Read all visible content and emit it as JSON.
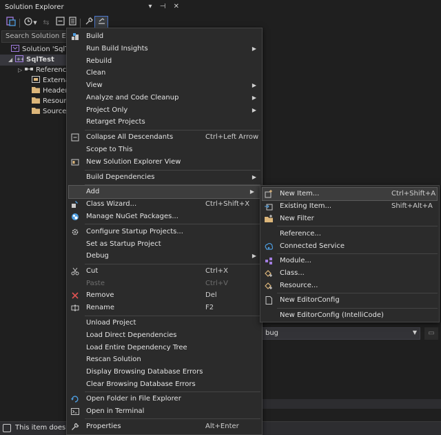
{
  "solution_explorer": {
    "title": "Solution Explorer",
    "title_controls": "▾ ⊣ ✕",
    "search_placeholder": "Search Solution Explo",
    "tree": [
      {
        "label": "Solution 'SqlTe",
        "icon": "solution-icon"
      },
      {
        "label": "SqlTest",
        "icon": "project-icon",
        "selected": true
      },
      {
        "label": "Referenc",
        "icon": "references-icon"
      },
      {
        "label": "External",
        "icon": "external-deps-icon"
      },
      {
        "label": "Header F",
        "icon": "folder-icon"
      },
      {
        "label": "Resource",
        "icon": "folder-icon"
      },
      {
        "label": "Source F",
        "icon": "folder-icon"
      }
    ]
  },
  "context_menu": {
    "items": [
      {
        "label": "Build",
        "shortcut": "",
        "icon": "build-icon"
      },
      {
        "label": "Run Build Insights",
        "shortcut": "",
        "submenu": true
      },
      {
        "label": "Rebuild",
        "shortcut": ""
      },
      {
        "label": "Clean",
        "shortcut": ""
      },
      {
        "label": "View",
        "shortcut": "",
        "submenu": true
      },
      {
        "label": "Analyze and Code Cleanup",
        "shortcut": "",
        "submenu": true
      },
      {
        "label": "Project Only",
        "shortcut": "",
        "submenu": true
      },
      {
        "label": "Retarget Projects",
        "shortcut": ""
      },
      {
        "label": "Collapse All Descendants",
        "shortcut": "Ctrl+Left Arrow",
        "icon": "collapse-icon"
      },
      {
        "label": "Scope to This",
        "shortcut": ""
      },
      {
        "label": "New Solution Explorer View",
        "shortcut": "",
        "icon": "new-view-icon"
      },
      {
        "label": "Build Dependencies",
        "shortcut": "",
        "submenu": true
      },
      {
        "label": "Add",
        "shortcut": "",
        "submenu": true,
        "highlighted": true
      },
      {
        "label": "Class Wizard...",
        "shortcut": "Ctrl+Shift+X",
        "icon": "class-wizard-icon"
      },
      {
        "label": "Manage NuGet Packages...",
        "shortcut": "",
        "icon": "nuget-icon"
      },
      {
        "label": "Configure Startup Projects...",
        "shortcut": "",
        "icon": "gear-icon"
      },
      {
        "label": "Set as Startup Project",
        "shortcut": ""
      },
      {
        "label": "Debug",
        "shortcut": "",
        "submenu": true
      },
      {
        "label": "Cut",
        "shortcut": "Ctrl+X",
        "icon": "scissors-icon"
      },
      {
        "label": "Paste",
        "shortcut": "Ctrl+V",
        "disabled": true
      },
      {
        "label": "Remove",
        "shortcut": "Del",
        "icon": "remove-x-icon"
      },
      {
        "label": "Rename",
        "shortcut": "F2",
        "icon": "rename-icon"
      },
      {
        "label": "Unload Project",
        "shortcut": ""
      },
      {
        "label": "Load Direct Dependencies",
        "shortcut": ""
      },
      {
        "label": "Load Entire Dependency Tree",
        "shortcut": ""
      },
      {
        "label": "Rescan Solution",
        "shortcut": ""
      },
      {
        "label": "Display Browsing Database Errors",
        "shortcut": ""
      },
      {
        "label": "Clear Browsing Database Errors",
        "shortcut": ""
      },
      {
        "label": "Open Folder in File Explorer",
        "shortcut": "",
        "icon": "open-folder-icon"
      },
      {
        "label": "Open in Terminal",
        "shortcut": "",
        "icon": "terminal-icon"
      },
      {
        "label": "Properties",
        "shortcut": "Alt+Enter",
        "icon": "wrench-icon"
      }
    ]
  },
  "add_submenu": {
    "items": [
      {
        "label": "New Item...",
        "shortcut": "Ctrl+Shift+A",
        "icon": "new-item-icon",
        "highlighted": true
      },
      {
        "label": "Existing Item...",
        "shortcut": "Shift+Alt+A",
        "icon": "existing-item-icon"
      },
      {
        "label": "New Filter",
        "shortcut": "",
        "icon": "new-filter-icon"
      },
      {
        "label": "Reference...",
        "shortcut": ""
      },
      {
        "label": "Connected Service",
        "shortcut": "",
        "icon": "connected-service-icon"
      },
      {
        "label": "Module...",
        "shortcut": "",
        "icon": "module-icon"
      },
      {
        "label": "Class...",
        "shortcut": "",
        "icon": "class-icon"
      },
      {
        "label": "Resource...",
        "shortcut": "",
        "icon": "resource-icon"
      },
      {
        "label": "New EditorConfig",
        "shortcut": "",
        "icon": "editorconfig-icon"
      },
      {
        "label": "New EditorConfig (IntelliCode)",
        "shortcut": ""
      }
    ]
  },
  "properties_panel": {
    "combo_value": "bug"
  },
  "status_bar": {
    "text": "This item does no"
  },
  "colors": {
    "background": "#1f1f1f",
    "menu_background": "#2b2b2b",
    "menu_border": "#454545",
    "highlight": "#3d3d3d",
    "accent_blue": "#4d9de0",
    "folder": "#dcb67a",
    "remove_red": "#e05252",
    "project_purple": "#a27de0"
  }
}
